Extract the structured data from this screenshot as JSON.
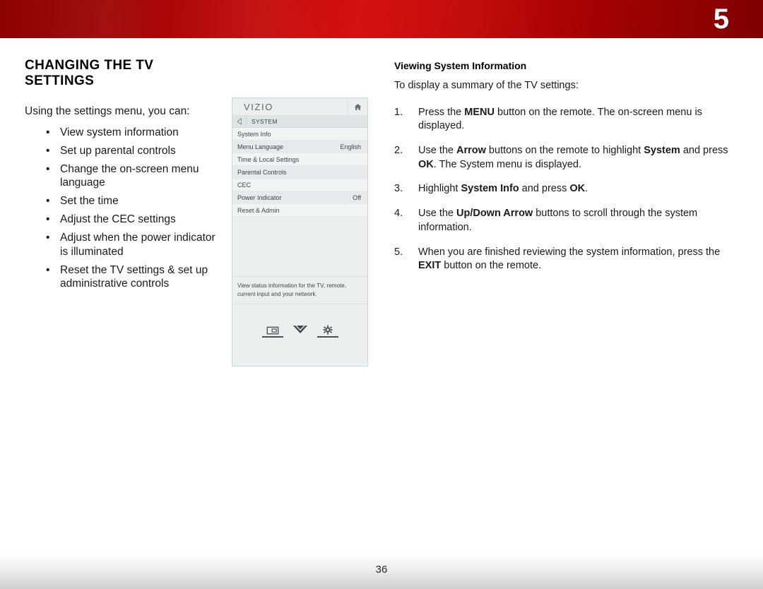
{
  "header": {
    "chapter_number": "5",
    "banner_color_dark": "#8c0000",
    "banner_color_bright": "#d51010"
  },
  "left_column": {
    "page_title": "CHANGING THE TV SETTINGS",
    "intro": "Using the settings menu, you can:",
    "bullet_marker": "•",
    "bullets": [
      "View system information",
      "Set up parental controls",
      "Change the on-screen menu language",
      "Set the time",
      "Adjust the CEC settings",
      "Adjust when the power indicator is illuminated",
      "Reset the TV settings & set up administrative controls"
    ]
  },
  "tv_menu": {
    "brand": "VIZIO",
    "home_icon": "home-icon",
    "back_icon": "back-arrow-icon",
    "breadcrumb": "SYSTEM",
    "rows": [
      {
        "label": "System Info",
        "value": ""
      },
      {
        "label": "Menu Language",
        "value": "English"
      },
      {
        "label": "Time & Local Settings",
        "value": ""
      },
      {
        "label": "Parental Controls",
        "value": ""
      },
      {
        "label": "CEC",
        "value": ""
      },
      {
        "label": "Power Indicator",
        "value": "Off"
      },
      {
        "label": "Reset & Admin",
        "value": ""
      }
    ],
    "help_text": "View status information for the TV, remote, current input and your network.",
    "footer_icons": [
      {
        "name": "picture-icon",
        "underlined": true
      },
      {
        "name": "chevron-down-icon",
        "underlined": false
      },
      {
        "name": "gear-icon",
        "underlined": true
      }
    ]
  },
  "right_column": {
    "heading": "Viewing System Information",
    "lead": "To display a summary of the TV settings:",
    "steps": [
      {
        "num": "1.",
        "parts": [
          {
            "t": "Press the ",
            "b": false
          },
          {
            "t": "MENU",
            "b": true
          },
          {
            "t": " button on the remote. The on-screen menu is displayed.",
            "b": false
          }
        ]
      },
      {
        "num": "2.",
        "parts": [
          {
            "t": "Use the ",
            "b": false
          },
          {
            "t": "Arrow",
            "b": true
          },
          {
            "t": " buttons on the remote to highlight ",
            "b": false
          },
          {
            "t": "System",
            "b": true
          },
          {
            "t": " and press ",
            "b": false
          },
          {
            "t": "OK",
            "b": true
          },
          {
            "t": ". The System menu is displayed.",
            "b": false
          }
        ]
      },
      {
        "num": "3.",
        "parts": [
          {
            "t": "Highlight ",
            "b": false
          },
          {
            "t": "System Info",
            "b": true
          },
          {
            "t": " and press ",
            "b": false
          },
          {
            "t": "OK",
            "b": true
          },
          {
            "t": ".",
            "b": false
          }
        ]
      },
      {
        "num": "4.",
        "parts": [
          {
            "t": "Use the ",
            "b": false
          },
          {
            "t": "Up/Down Arrow",
            "b": true
          },
          {
            "t": " buttons to scroll through the system information.",
            "b": false
          }
        ]
      },
      {
        "num": "5.",
        "parts": [
          {
            "t": "When you are finished reviewing the system information, press the ",
            "b": false
          },
          {
            "t": "EXIT",
            "b": true
          },
          {
            "t": " button on the remote.",
            "b": false
          }
        ]
      }
    ]
  },
  "footer": {
    "page_number": "36"
  }
}
